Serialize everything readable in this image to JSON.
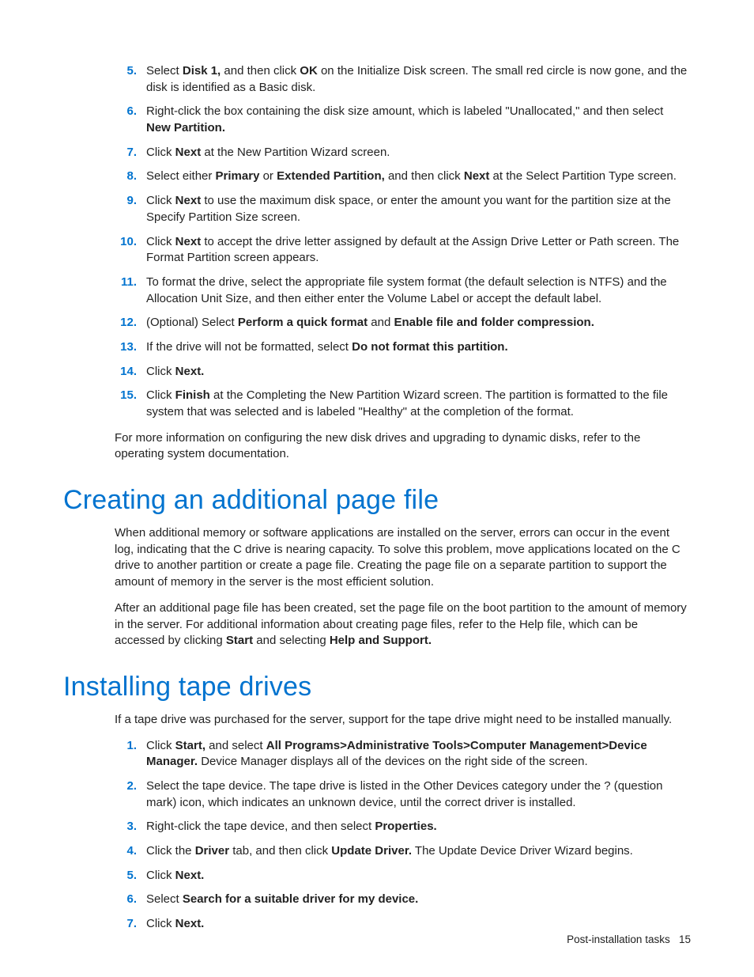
{
  "steps1": {
    "5": {
      "pre": "Select ",
      "b1": "Disk 1,",
      "mid": " and then click ",
      "b2": "OK",
      "post": " on the Initialize Disk screen. The small red circle is now gone, and the disk is identified as a Basic disk."
    },
    "6": {
      "pre": "Right-click the box containing the disk size amount, which is labeled \"Unallocated,\" and then select ",
      "b1": "New Partition.",
      "post": ""
    },
    "7": {
      "pre": "Click ",
      "b1": "Next",
      "post": " at the New Partition Wizard screen."
    },
    "8": {
      "pre": "Select either ",
      "b1": "Primary",
      "mid": " or ",
      "b2": "Extended Partition,",
      "mid2": " and then click ",
      "b3": "Next",
      "post": " at the Select Partition Type screen."
    },
    "9": {
      "pre": "Click ",
      "b1": "Next",
      "post": " to use the maximum disk space, or enter the amount you want for the partition size at the Specify Partition Size screen."
    },
    "10": {
      "pre": "Click ",
      "b1": "Next",
      "post": " to accept the drive letter assigned by default at the Assign Drive Letter or Path screen. The Format Partition screen appears."
    },
    "11": {
      "pre": "To format the drive, select the appropriate file system format (the default selection is NTFS) and the Allocation Unit Size, and then either enter the Volume Label or accept the default label.",
      "b1": "",
      "post": ""
    },
    "12": {
      "pre": "(Optional) Select ",
      "b1": "Perform a quick format",
      "mid": " and ",
      "b2": "Enable file and folder compression.",
      "post": ""
    },
    "13": {
      "pre": "If the drive will not be formatted, select ",
      "b1": "Do not format this partition.",
      "post": ""
    },
    "14": {
      "pre": "Click ",
      "b1": "Next.",
      "post": ""
    },
    "15": {
      "pre": "Click ",
      "b1": "Finish",
      "post": " at the Completing the New Partition Wizard screen. The partition is formatted to the file system that was selected and is labeled \"Healthy\" at the completion of the format."
    }
  },
  "para_after_steps1": "For more information on configuring the new disk drives and upgrading to dynamic disks, refer to the operating system documentation.",
  "heading1": "Creating an additional page file",
  "para_h1_a": "When additional memory or software applications are installed on the server, errors can occur in the event log, indicating that the C drive is nearing capacity. To solve this problem, move applications located on the C drive to another partition or create a page file. Creating the page file on a separate partition to support the amount of memory in the server is the most efficient solution.",
  "para_h1_b": {
    "pre": "After an additional page file has been created, set the page file on the boot partition to the amount of memory in the server. For additional information about creating page files, refer to the Help file, which can be accessed by clicking ",
    "b1": "Start",
    "mid": " and selecting ",
    "b2": "Help and Support.",
    "post": ""
  },
  "heading2": "Installing tape drives",
  "para_h2_a": "If a tape drive was purchased for the server, support for the tape drive might need to be installed manually.",
  "steps2": {
    "1": {
      "pre": "Click ",
      "b1": "Start,",
      "mid": " and select ",
      "b2": "All Programs>Administrative Tools>Computer Management>Device Manager.",
      "post": " Device Manager displays all of the devices on the right side of the screen."
    },
    "2": {
      "pre": "Select the tape device. The tape drive is listed in the Other Devices category under the ? (question mark) icon, which indicates an unknown device, until the correct driver is installed.",
      "b1": "",
      "post": ""
    },
    "3": {
      "pre": "Right-click the tape device, and then select ",
      "b1": "Properties.",
      "post": ""
    },
    "4": {
      "pre": "Click the ",
      "b1": "Driver",
      "mid": " tab, and then click ",
      "b2": "Update Driver.",
      "post": " The Update Device Driver Wizard begins."
    },
    "5": {
      "pre": "Click ",
      "b1": "Next.",
      "post": ""
    },
    "6": {
      "pre": "Select ",
      "b1": "Search for a suitable driver for my device.",
      "post": ""
    },
    "7": {
      "pre": "Click ",
      "b1": "Next.",
      "post": ""
    }
  },
  "footer": {
    "label": "Post-installation tasks",
    "page": "15"
  }
}
